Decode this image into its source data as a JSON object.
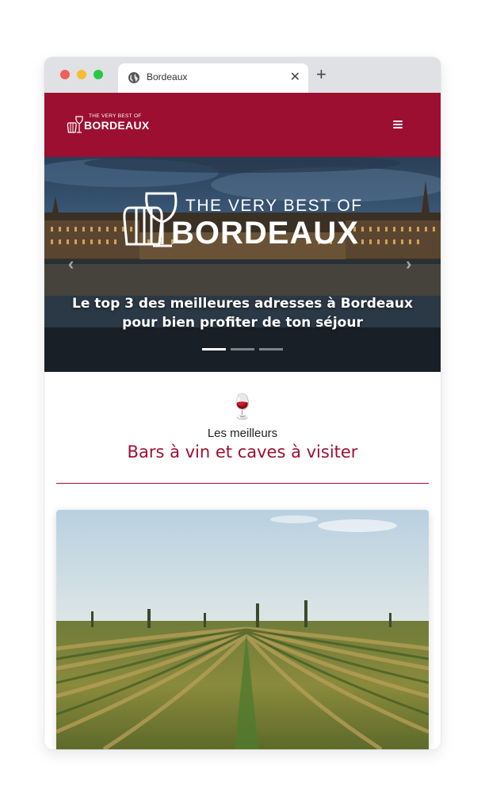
{
  "browser": {
    "tab_title": "Bordeaux",
    "close_symbol": "✕",
    "new_tab_symbol": "+",
    "globe_icon": "globe-icon"
  },
  "header": {
    "logo_small": "THE VERY BEST OF",
    "logo_big": "BORDEAUX",
    "menu_icon": "hamburger-icon",
    "background": "#9c0f30"
  },
  "hero": {
    "logo_small": "THE VERY BEST OF",
    "logo_big": "BORDEAUX",
    "caption": "Le top 3 des meilleures adresses à Bordeaux pour bien profiter de ton séjour",
    "prev_symbol": "‹",
    "next_symbol": "›",
    "slides": 3,
    "active_slide": 1
  },
  "section": {
    "icon": "🍷",
    "pretitle": "Les meilleurs",
    "title": "Bars à vin et caves à visiter",
    "accent": "#9c0f30"
  }
}
